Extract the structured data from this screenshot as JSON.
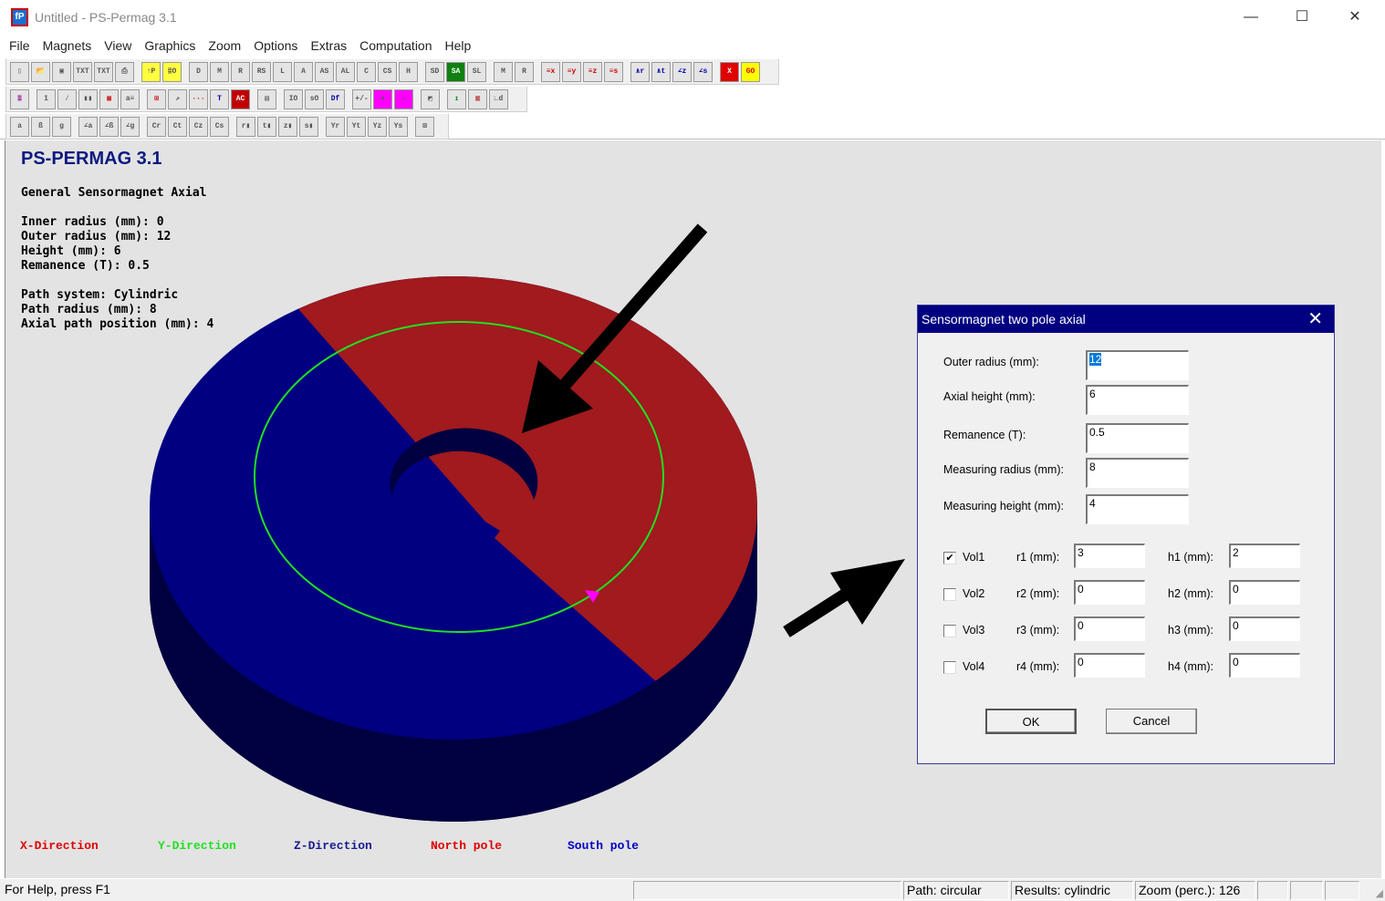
{
  "window": {
    "title": "Untitled - PS-Permag 3.1",
    "app_icon_text": "fP",
    "minimize": "—",
    "maximize": "☐",
    "close": "✕"
  },
  "menu": [
    "File",
    "Magnets",
    "View",
    "Graphics",
    "Zoom",
    "Options",
    "Extras",
    "Computation",
    "Help"
  ],
  "toolbars": [
    [
      {
        "name": "new-file-icon",
        "g": "▯"
      },
      {
        "name": "open-folder-icon",
        "g": "📂"
      },
      {
        "name": "save-icon",
        "g": "▣"
      },
      {
        "name": "txt-export-icon",
        "g": "TXT"
      },
      {
        "name": "txt-export-red-icon",
        "g": "TXT"
      },
      {
        "name": "print-icon",
        "g": "⎙"
      },
      {
        "name": "tp-icon",
        "g": "↑P",
        "bg": "#ffff40",
        "gap": 1
      },
      {
        "name": "eo-icon",
        "g": "≣O",
        "bg": "#ffff40"
      },
      {
        "name": "3d-d-icon",
        "g": "D",
        "gap": 1
      },
      {
        "name": "3d-m-icon",
        "g": "M"
      },
      {
        "name": "3d-r-icon",
        "g": "R"
      },
      {
        "name": "3d-rs-icon",
        "g": "RS"
      },
      {
        "name": "3d-l-icon",
        "g": "L"
      },
      {
        "name": "3d-a-icon",
        "g": "A"
      },
      {
        "name": "3d-as-icon",
        "g": "AS"
      },
      {
        "name": "3d-al-icon",
        "g": "AL"
      },
      {
        "name": "3d-c-icon",
        "g": "C"
      },
      {
        "name": "3d-cs-icon",
        "g": "CS"
      },
      {
        "name": "3d-h-icon",
        "g": "H"
      },
      {
        "name": "3d-sd-icon",
        "g": "SD",
        "gap": 1
      },
      {
        "name": "3d-sa-icon",
        "g": "SA",
        "bg": "#108010",
        "fg": "#fff"
      },
      {
        "name": "3d-sl-icon",
        "g": "SL"
      },
      {
        "name": "3d-m2-icon",
        "g": "M",
        "gap": 1
      },
      {
        "name": "3d-r2-icon",
        "g": "R"
      },
      {
        "name": "field-x-icon",
        "g": "≡x",
        "gap": 1,
        "fg": "#c00"
      },
      {
        "name": "field-y-icon",
        "g": "≡y",
        "fg": "#c00"
      },
      {
        "name": "field-z-icon",
        "g": "≡z",
        "fg": "#c00"
      },
      {
        "name": "field-s-icon",
        "g": "≡s",
        "fg": "#c00"
      },
      {
        "name": "graph-r-icon",
        "g": "∧r",
        "gap": 1,
        "fg": "#00a"
      },
      {
        "name": "graph-t-icon",
        "g": "∧t",
        "fg": "#00a"
      },
      {
        "name": "graph-z-icon",
        "g": "∠z",
        "fg": "#00a"
      },
      {
        "name": "graph-s-icon",
        "g": "∠s",
        "fg": "#00a"
      },
      {
        "name": "stop-icon",
        "g": "X",
        "bg": "#e00000",
        "fg": "#fff",
        "gap": 1
      },
      {
        "name": "go-icon",
        "g": "GO",
        "bg": "#ffff00",
        "fg": "#e00000"
      }
    ],
    [
      {
        "name": "layers-icon",
        "g": "≣",
        "fg": "#808"
      },
      {
        "name": "bar-icon",
        "g": "ī",
        "gap": 1
      },
      {
        "name": "line-icon",
        "g": "⁄"
      },
      {
        "name": "histogram-icon",
        "g": "▮▮"
      },
      {
        "name": "color-grid-icon",
        "g": "▦",
        "fg": "#c00"
      },
      {
        "name": "text-color-icon",
        "g": "a≡"
      },
      {
        "name": "grid-icon",
        "g": "⊞",
        "gap": 1,
        "fg": "#c00"
      },
      {
        "name": "axes-icon",
        "g": "↗"
      },
      {
        "name": "dots-icon",
        "g": "···",
        "fg": "#c00"
      },
      {
        "name": "t-icon",
        "g": "T",
        "fg": "#00a"
      },
      {
        "name": "ac-icon",
        "g": "AC",
        "bg": "#c00000",
        "fg": "#fff"
      },
      {
        "name": "table-icon",
        "g": "▤",
        "gap": 1
      },
      {
        "name": "io-icon",
        "g": "IO",
        "gap": 1
      },
      {
        "name": "so-icon",
        "g": "sO"
      },
      {
        "name": "df-icon",
        "g": "Df",
        "fg": "#00a"
      },
      {
        "name": "plus-minus-icon",
        "g": "+/-",
        "gap": 1
      },
      {
        "name": "plus-icon",
        "g": "+",
        "bg": "#ff00ff"
      },
      {
        "name": "minus-icon",
        "g": "-",
        "bg": "#ff00ff"
      },
      {
        "name": "diagonal-icon",
        "g": "◩",
        "gap": 1
      },
      {
        "name": "move-icon",
        "g": "↥",
        "gap": 1,
        "fg": "#080"
      },
      {
        "name": "columns-icon",
        "g": "▥",
        "fg": "#a00"
      },
      {
        "name": "3d-axis-icon",
        "g": "∟d"
      }
    ],
    [
      {
        "name": "alpha-icon",
        "g": "a"
      },
      {
        "name": "beta-icon",
        "g": "ß"
      },
      {
        "name": "gamma-icon",
        "g": "g"
      },
      {
        "name": "angle-alpha-icon",
        "g": "∠a",
        "gap": 1
      },
      {
        "name": "angle-beta-icon",
        "g": "∠ß"
      },
      {
        "name": "angle-gamma-icon",
        "g": "∠g"
      },
      {
        "name": "c-r-icon",
        "g": "Cr",
        "gap": 1
      },
      {
        "name": "c-t-icon",
        "g": "Ct"
      },
      {
        "name": "c-z-icon",
        "g": "Cz"
      },
      {
        "name": "c-s-icon",
        "g": "Cs"
      },
      {
        "name": "r-bars-icon",
        "g": "r▮",
        "gap": 1
      },
      {
        "name": "t-bars-icon",
        "g": "t▮"
      },
      {
        "name": "z-bars-icon",
        "g": "z▮"
      },
      {
        "name": "s-bars-icon",
        "g": "s▮"
      },
      {
        "name": "yr-icon",
        "g": "Yr",
        "gap": 1
      },
      {
        "name": "yt-icon",
        "g": "Yt"
      },
      {
        "name": "yz-icon",
        "g": "Yz"
      },
      {
        "name": "ys-icon",
        "g": "Ys"
      },
      {
        "name": "image-icon",
        "g": "⊠",
        "gap": 1
      }
    ]
  ],
  "canvas": {
    "heading": "PS-PERMAG 3.1",
    "magnet_type": "General Sensormagnet Axial",
    "params": [
      "Inner radius (mm): 0",
      "Outer radius (mm): 12",
      "Height (mm): 6",
      "Remanence (T): 0.5"
    ],
    "path": [
      "Path system: Cylindric",
      "Path radius (mm): 8",
      "Axial path position (mm): 4"
    ],
    "legend": [
      {
        "label": "X-Direction",
        "color": "#e00000"
      },
      {
        "label": "Y-Direction",
        "color": "#20e020"
      },
      {
        "label": "Z-Direction",
        "color": "#1a1a90"
      },
      {
        "label": "North pole",
        "color": "#e00000"
      },
      {
        "label": "South pole",
        "color": "#0000c0"
      }
    ],
    "colors": {
      "north": "#a01a1e",
      "south": "#000080",
      "side": "#000040",
      "path": "#20e020",
      "marker": "#ff00ff",
      "background": "#e3e3e3"
    }
  },
  "dialog": {
    "title": "Sensormagnet two pole axial",
    "fields": [
      {
        "label": "Outer radius (mm):",
        "value": "12"
      },
      {
        "label": "Axial height (mm):",
        "value": "6"
      },
      {
        "label": "Remanence (T):",
        "value": "0.5"
      },
      {
        "label": "Measuring radius (mm):",
        "value": "8"
      },
      {
        "label": "Measuring height (mm):",
        "value": "4"
      }
    ],
    "volumes": [
      {
        "label": "Vol1",
        "checked": true,
        "r_label": "r1 (mm):",
        "r": "3",
        "h_label": "h1 (mm):",
        "h": "2"
      },
      {
        "label": "Vol2",
        "checked": false,
        "r_label": "r2 (mm):",
        "r": "0",
        "h_label": "h2 (mm):",
        "h": "0"
      },
      {
        "label": "Vol3",
        "checked": false,
        "r_label": "r3 (mm):",
        "r": "0",
        "h_label": "h3 (mm):",
        "h": "0"
      },
      {
        "label": "Vol4",
        "checked": false,
        "r_label": "r4 (mm):",
        "r": "0",
        "h_label": "h4 (mm):",
        "h": "0"
      }
    ],
    "ok": "OK",
    "cancel": "Cancel",
    "check_mark": "✔"
  },
  "status": {
    "help": "For Help, press F1",
    "blank": "",
    "path": "Path: circular",
    "results": "Results: cylindric",
    "zoom": "Zoom (perc.): 126"
  }
}
